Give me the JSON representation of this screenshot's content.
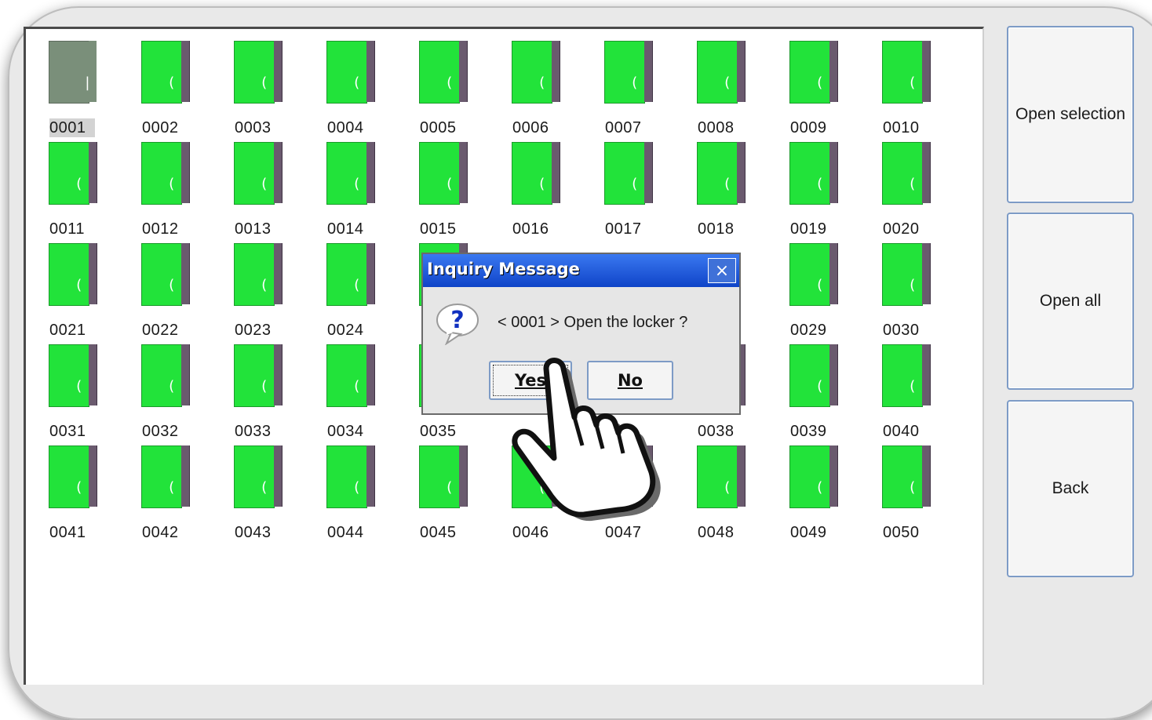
{
  "lockers": {
    "row1": [
      "0001",
      "0002",
      "0003",
      "0004",
      "0005",
      "0006",
      "0007",
      "0008",
      "0009",
      "0010"
    ],
    "row2": [
      "0011",
      "0012",
      "0013",
      "0014",
      "0015",
      "0016",
      "0017",
      "0018",
      "0019",
      "0020"
    ],
    "row3": [
      "0021",
      "0022",
      "0023",
      "0024",
      "0029",
      "0030"
    ],
    "row4": [
      "0031",
      "0032",
      "0033",
      "0034",
      "0035",
      "0038",
      "0039",
      "0040"
    ],
    "row5": [
      "0041",
      "0042",
      "0043",
      "0044",
      "0045",
      "0046",
      "0047",
      "0048",
      "0049",
      "0050"
    ],
    "selected": "0001",
    "closed_color": "#22e33a",
    "selected_color": "#7a8f7a"
  },
  "sidebar": {
    "open_selection": "Open selection",
    "open_all": "Open all",
    "back": "Back"
  },
  "dialog": {
    "title": "Inquiry Message",
    "close_icon": "×",
    "question_icon": "question-icon",
    "message": "< 0001 > Open the locker ?",
    "yes": "Yes",
    "no": "No"
  },
  "overlay": {
    "icon": "pointing-hand-icon"
  }
}
